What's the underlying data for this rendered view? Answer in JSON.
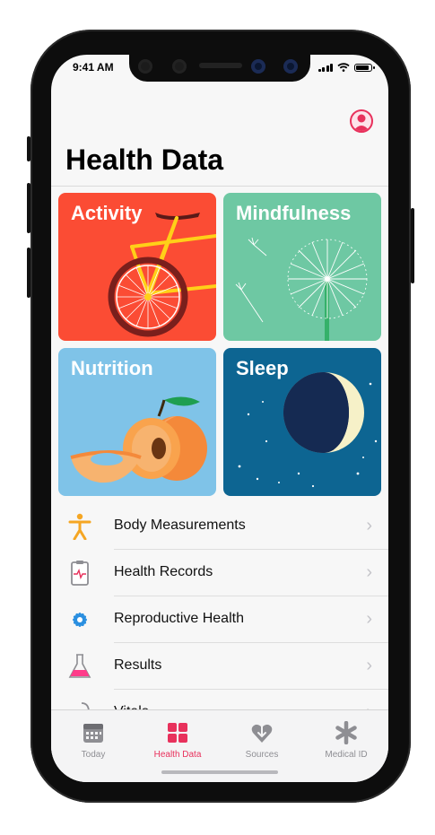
{
  "status_bar": {
    "time": "9:41 AM"
  },
  "header": {
    "title": "Health Data"
  },
  "tiles": [
    {
      "label": "Activity",
      "color": "#fb4c34"
    },
    {
      "label": "Mindfulness",
      "color": "#6ec8a3"
    },
    {
      "label": "Nutrition",
      "color": "#7fc3e8"
    },
    {
      "label": "Sleep",
      "color": "#0d6592"
    }
  ],
  "list": [
    {
      "label": "Body Measurements",
      "icon": "person-icon"
    },
    {
      "label": "Health Records",
      "icon": "clipboard-icon"
    },
    {
      "label": "Reproductive Health",
      "icon": "flower-icon"
    },
    {
      "label": "Results",
      "icon": "flask-icon"
    },
    {
      "label": "Vitals",
      "icon": "stethoscope-icon"
    }
  ],
  "tabbar": {
    "tabs": [
      {
        "label": "Today",
        "icon": "calendar-icon"
      },
      {
        "label": "Health Data",
        "icon": "grid-icon",
        "active": true
      },
      {
        "label": "Sources",
        "icon": "heart-arrow-icon"
      },
      {
        "label": "Medical ID",
        "icon": "asterisk-icon"
      }
    ]
  },
  "colors": {
    "accent": "#e8315c",
    "chevron": "#c4c4c9"
  }
}
